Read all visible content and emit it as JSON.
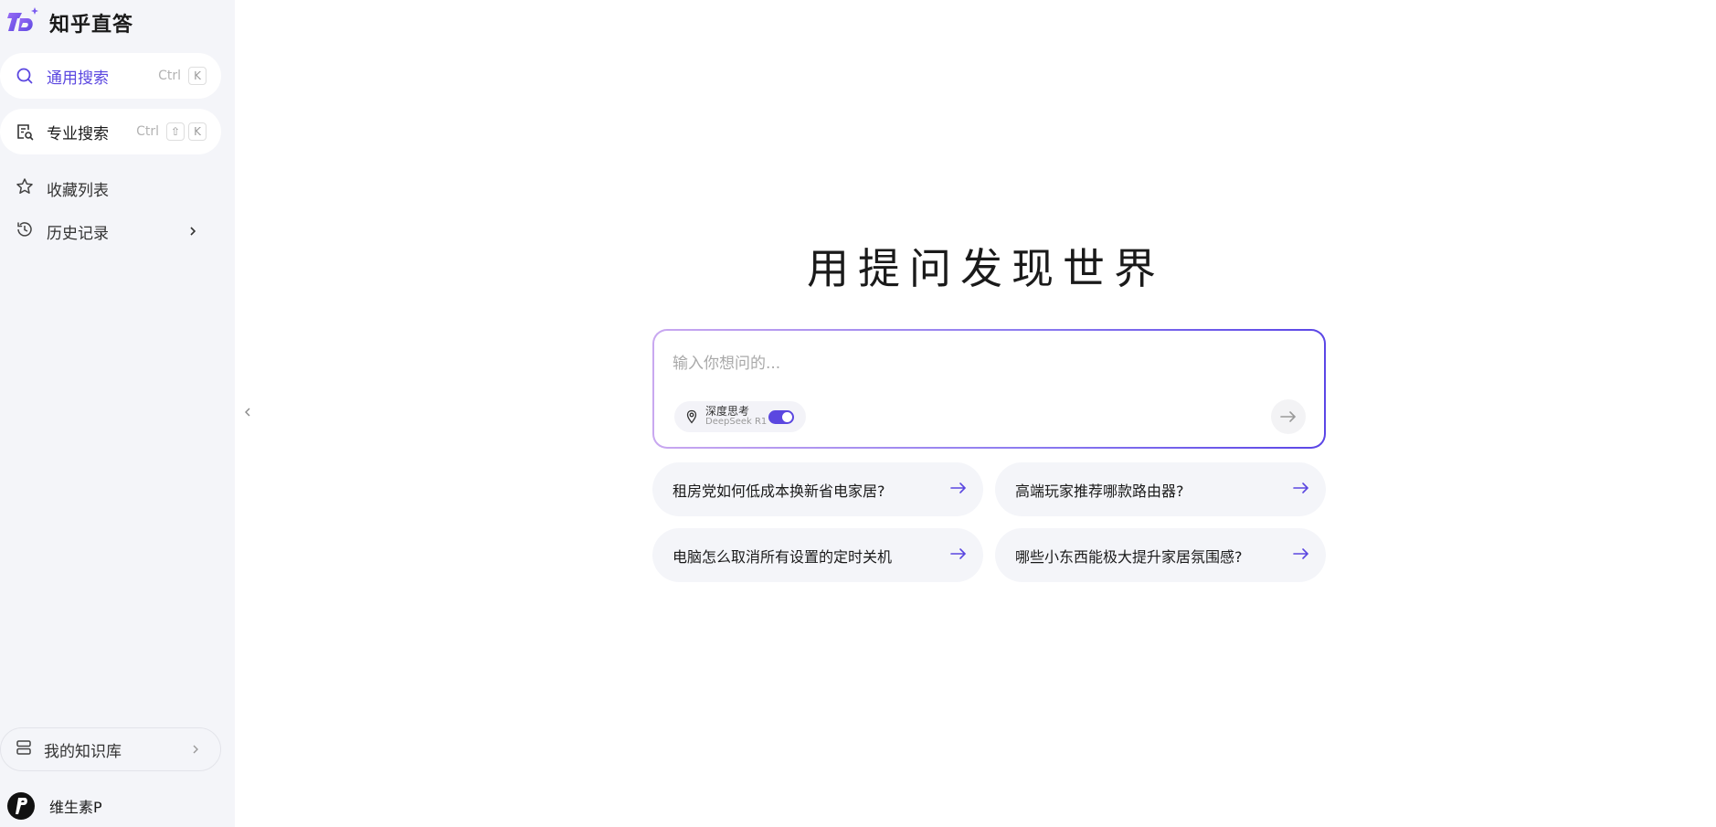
{
  "brand": {
    "name": "知乎直答"
  },
  "nav": {
    "general_search": {
      "label": "通用搜索",
      "shortcut_ctrl": "Ctrl",
      "shortcut_key": "K"
    },
    "pro_search": {
      "label": "专业搜索",
      "shortcut_ctrl": "Ctrl",
      "shortcut_shift": "⇧",
      "shortcut_key": "K"
    },
    "favorites": {
      "label": "收藏列表"
    },
    "history": {
      "label": "历史记录"
    },
    "knowledge_base": {
      "label": "我的知识库"
    }
  },
  "user": {
    "name": "维生素P"
  },
  "main": {
    "headline": "用提问发现世界",
    "ask": {
      "placeholder": "输入你想问的...",
      "deep_think_title": "深度思考",
      "deep_think_model": "DeepSeek R1",
      "deep_think_enabled": true
    },
    "suggestions": [
      {
        "text": "租房党如何低成本换新省电家居?"
      },
      {
        "text": "高端玩家推荐哪款路由器?"
      },
      {
        "text": "电脑怎么取消所有设置的定时关机"
      },
      {
        "text": "哪些小东西能极大提升家居氛围感?"
      }
    ]
  },
  "colors": {
    "accent": "#5b47e0",
    "sidebar_bg": "#f4f5f9",
    "card_bg": "#f4f5f9"
  },
  "icons": [
    "brand-logo-icon",
    "search-icon",
    "pro-search-icon",
    "star-icon",
    "clock-icon",
    "chevron-right-icon",
    "database-icon",
    "collapse-chevron-icon",
    "lightbulb-icon",
    "arrow-right-icon"
  ]
}
